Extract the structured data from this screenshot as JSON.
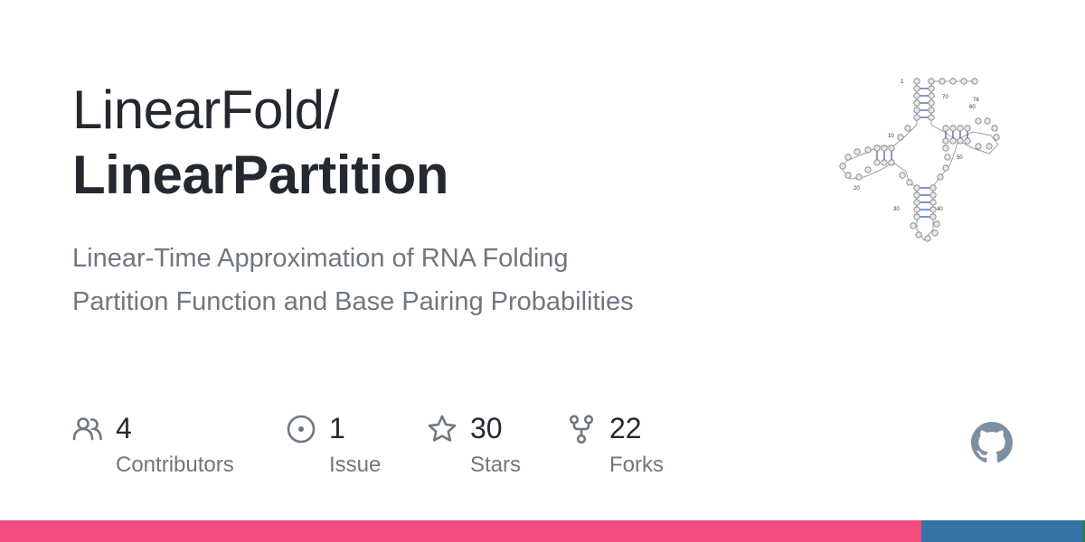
{
  "repo": {
    "owner": "LinearFold/",
    "name": "LinearPartition",
    "description_line1": "Linear-Time Approximation of RNA Folding",
    "description_line2": "Partition Function and Base Pairing Probabilities"
  },
  "stats": [
    {
      "icon": "people-icon",
      "value": "4",
      "label": "Contributors"
    },
    {
      "icon": "issue-icon",
      "value": "1",
      "label": "Issue"
    },
    {
      "icon": "star-icon",
      "value": "30",
      "label": "Stars"
    },
    {
      "icon": "fork-icon",
      "value": "22",
      "label": "Forks"
    }
  ],
  "rna_labels": [
    "1",
    "10",
    "20",
    "30",
    "40",
    "50",
    "60",
    "70",
    "76"
  ],
  "languages": [
    {
      "color": "#f34b7d",
      "fraction": 0.849
    },
    {
      "color": "#3572A5",
      "fraction": 0.149
    },
    {
      "color": "#2f7d32",
      "fraction": 0.002
    }
  ],
  "colors": {
    "accent": "#24292f",
    "muted": "#6e7781",
    "logo": "#7d8fa3"
  }
}
